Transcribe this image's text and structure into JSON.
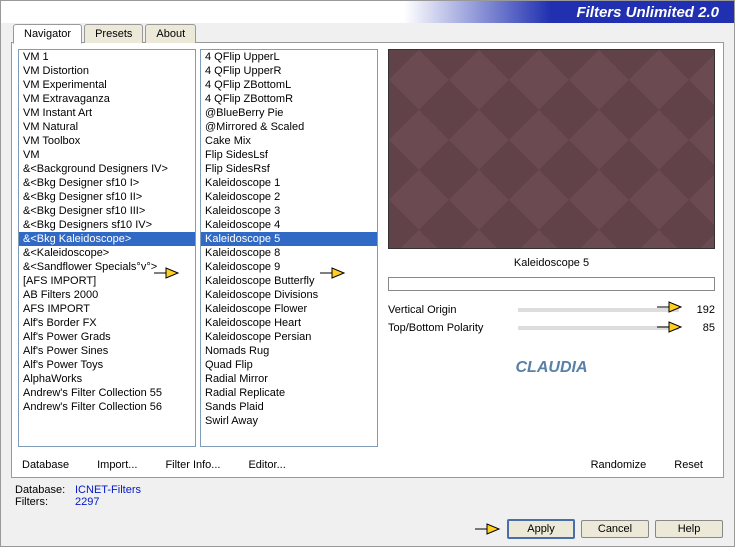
{
  "header": {
    "title": "Filters Unlimited 2.0"
  },
  "tabs": [
    {
      "label": "Navigator",
      "active": true
    },
    {
      "label": "Presets",
      "active": false
    },
    {
      "label": "About",
      "active": false
    }
  ],
  "column1": {
    "items": [
      "VM 1",
      "VM Distortion",
      "VM Experimental",
      "VM Extravaganza",
      "VM Instant Art",
      "VM Natural",
      "VM Toolbox",
      "VM",
      "&<Background Designers IV>",
      "&<Bkg Designer sf10 I>",
      "&<Bkg Designer sf10 II>",
      "&<Bkg Designer sf10 III>",
      "&<Bkg Designers sf10 IV>",
      "&<Bkg Kaleidoscope>",
      "&<Kaleidoscope>",
      "&<Sandflower Specials°v°>",
      "[AFS IMPORT]",
      "AB Filters 2000",
      "AFS IMPORT",
      "Alf's Border FX",
      "Alf's Power Grads",
      "Alf's Power Sines",
      "Alf's Power Toys",
      "AlphaWorks",
      "Andrew's Filter Collection 55",
      "Andrew's Filter Collection 56"
    ],
    "selected": 13
  },
  "column2": {
    "items": [
      "4 QFlip UpperL",
      "4 QFlip UpperR",
      "4 QFlip ZBottomL",
      "4 QFlip ZBottomR",
      "@BlueBerry Pie",
      "@Mirrored & Scaled",
      "Cake Mix",
      "Flip SidesLsf",
      "Flip SidesRsf",
      "Kaleidoscope 1",
      "Kaleidoscope 2",
      "Kaleidoscope 3",
      "Kaleidoscope 4",
      "Kaleidoscope 5",
      "Kaleidoscope 8",
      "Kaleidoscope 9",
      "Kaleidoscope Butterfly",
      "Kaleidoscope Divisions",
      "Kaleidoscope Flower",
      "Kaleidoscope Heart",
      "Kaleidoscope Persian",
      "Nomads Rug",
      "Quad Flip",
      "Radial Mirror",
      "Radial Replicate",
      "Sands Plaid",
      "Swirl Away"
    ],
    "selected": 13
  },
  "preview": {
    "label": "Kaleidoscope 5"
  },
  "params": [
    {
      "label": "Vertical Origin",
      "value": "192"
    },
    {
      "label": "Top/Bottom Polarity",
      "value": "85"
    }
  ],
  "watermark": "CLAUDIA",
  "bottomLinks": {
    "database": "Database",
    "import": "Import...",
    "filterInfo": "Filter Info...",
    "editor": "Editor...",
    "randomize": "Randomize",
    "reset": "Reset"
  },
  "footer": {
    "dbLabel": "Database:",
    "dbValue": "ICNET-Filters",
    "filtersLabel": "Filters:",
    "filtersValue": "2297"
  },
  "buttons": {
    "apply": "Apply",
    "cancel": "Cancel",
    "help": "Help"
  }
}
